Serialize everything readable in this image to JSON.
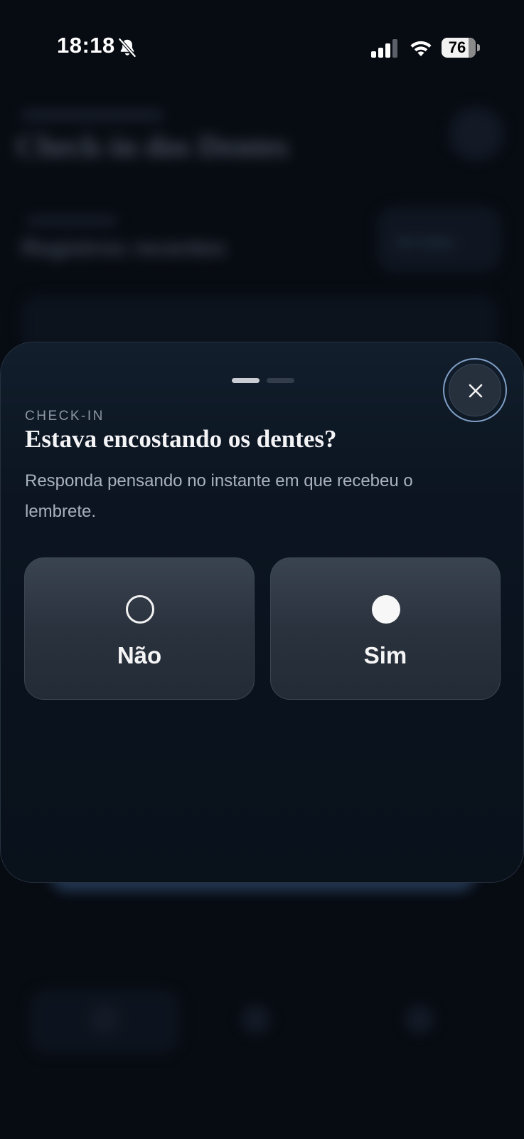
{
  "status_bar": {
    "time": "18:18",
    "battery": "76",
    "icons": [
      "bell-slash-icon",
      "cellular-signal-icon",
      "wifi-icon",
      "battery-icon"
    ]
  },
  "background": {
    "title": "Check-in dos Dentes",
    "card_title": "Registros recentes",
    "pill_label": "Ver todos"
  },
  "sheet": {
    "eyebrow": "CHECK-IN",
    "question": "Estava encostando os dentes?",
    "helper": "Responda pensando no instante em que recebeu o lembrete.",
    "pager": {
      "count": 2,
      "active": 0
    },
    "close_icon": "close-icon",
    "options": [
      {
        "label": "Não",
        "icon": "radio-empty-icon"
      },
      {
        "label": "Sim",
        "icon": "radio-filled-icon"
      }
    ]
  },
  "colors": {
    "background": "#070b12",
    "sheet": "#0b1420",
    "option": "#2a323e",
    "close_ring": "#7f9ec5",
    "text_primary": "#f4f4f6",
    "text_secondary": "#a9b1bc"
  }
}
